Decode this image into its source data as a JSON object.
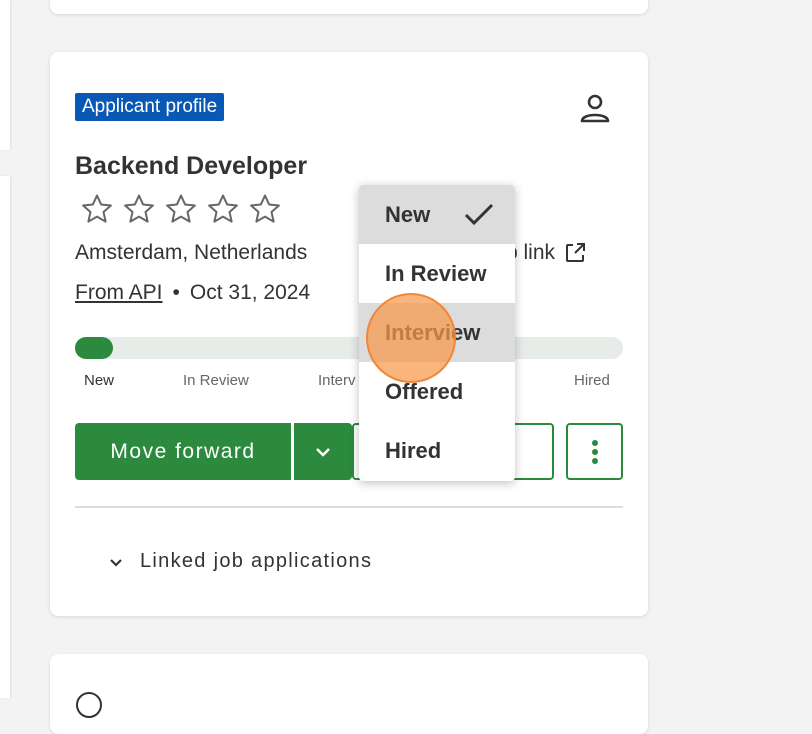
{
  "card": {
    "badge": "Applicant profile",
    "title": "Backend Developer",
    "rating": {
      "filled": 0,
      "max": 5
    },
    "location": "Amsterdam, Netherlands",
    "job_link": "b link",
    "source": "From API",
    "separator": "•",
    "date": "Oct 31, 2024",
    "progress": {
      "value": 0.07
    },
    "stages": [
      "New",
      "In Review",
      "Interv",
      "Hired"
    ],
    "primary_button": "Move forward",
    "linked_section": "Linked job applications"
  },
  "dropdown": {
    "items": [
      {
        "label": "New",
        "selected": true
      },
      {
        "label": "In Review"
      },
      {
        "label": "Interview",
        "hover": true
      },
      {
        "label": "Offered"
      },
      {
        "label": "Hired"
      }
    ]
  },
  "colors": {
    "accent": "#2b8a3e",
    "badge": "#0a58b6",
    "cursor": "#f79848"
  },
  "icons": [
    "person-icon",
    "star-outline-icon",
    "external-link-icon",
    "chevron-down-icon",
    "more-vertical-icon",
    "check-icon"
  ]
}
